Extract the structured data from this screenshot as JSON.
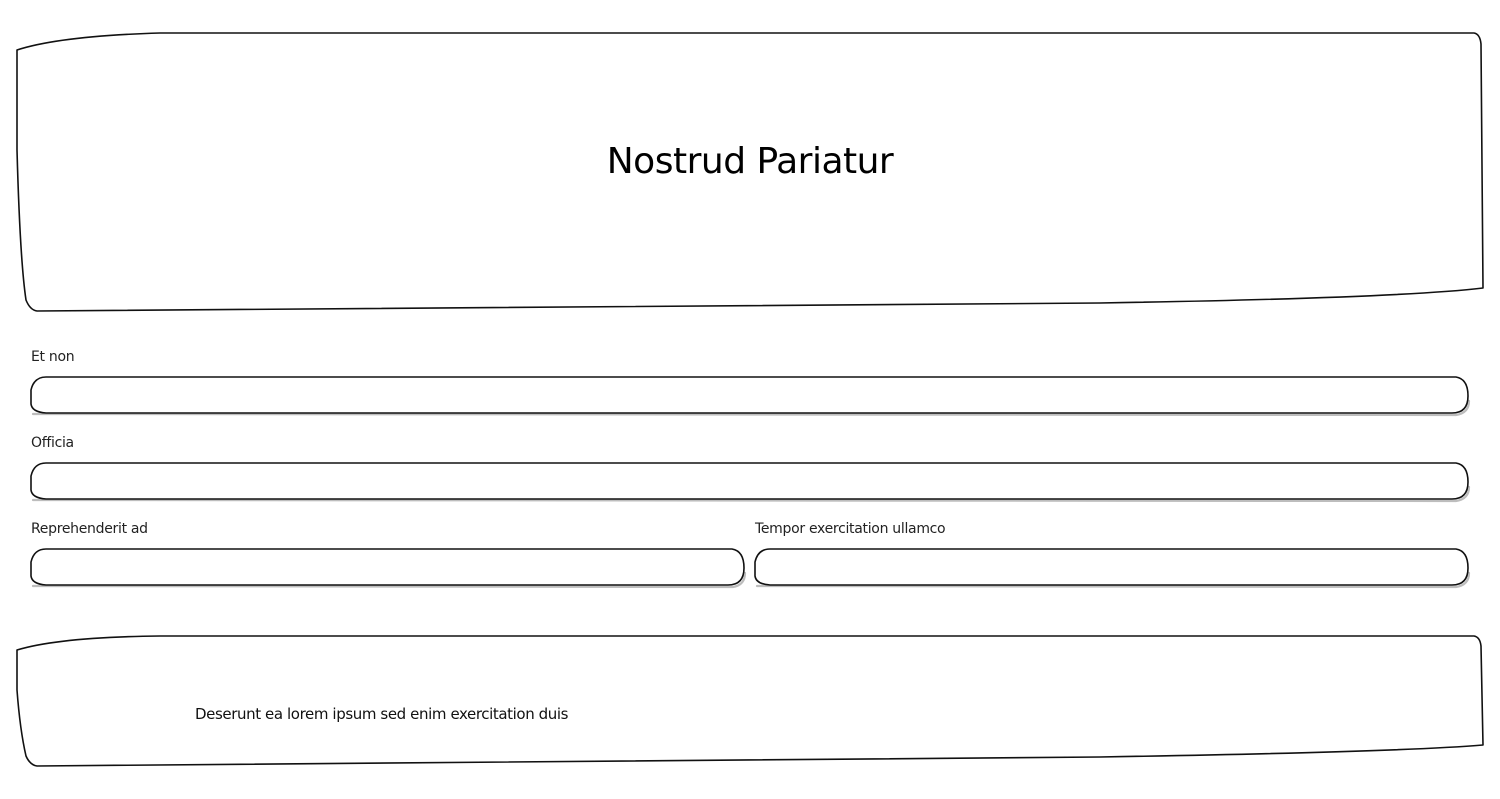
{
  "header": {
    "title": "Nostrud Pariatur"
  },
  "form": {
    "fields": [
      {
        "label": "Et non",
        "value": "",
        "placeholder": ""
      },
      {
        "label": "Officia",
        "value": "",
        "placeholder": ""
      },
      {
        "label": "Reprehenderit ad",
        "value": "",
        "placeholder": ""
      },
      {
        "label": "Tempor exercitation ullamco",
        "value": "",
        "placeholder": ""
      }
    ]
  },
  "footer": {
    "text": "Deserunt ea lorem ipsum sed enim exercitation duis"
  }
}
